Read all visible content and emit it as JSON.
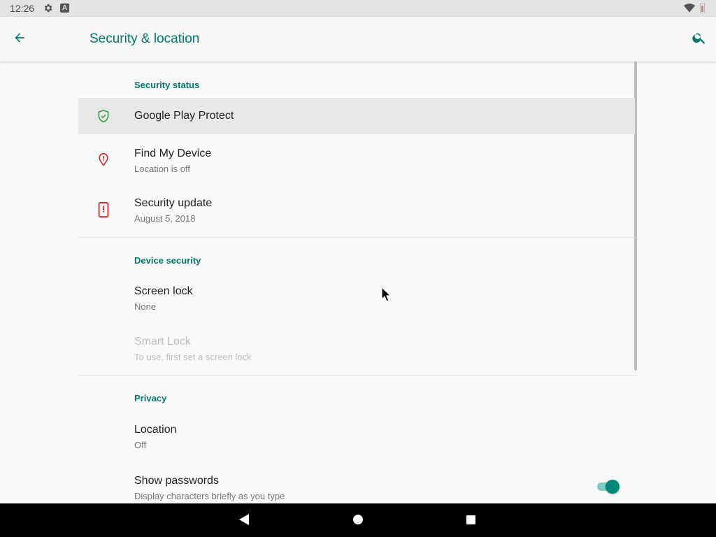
{
  "status_bar": {
    "time": "12:26",
    "icons": [
      "settings-icon",
      "a-notification-icon",
      "wifi-icon",
      "battery-icon"
    ]
  },
  "app_bar": {
    "title": "Security & location",
    "back_icon": "arrow-back-icon",
    "search_icon": "search-icon"
  },
  "sections": {
    "security_status": {
      "header": "Security status",
      "items": [
        {
          "title": "Google Play Protect",
          "summary": "",
          "icon": "shield-check-icon",
          "icon_color": "#43a047"
        },
        {
          "title": "Find My Device",
          "summary": "Location is off",
          "icon": "location-alert-icon",
          "icon_color": "#d32f2f"
        },
        {
          "title": "Security update",
          "summary": "August 5, 2018",
          "icon": "phone-alert-icon",
          "icon_color": "#d32f2f"
        }
      ]
    },
    "device_security": {
      "header": "Device security",
      "items": [
        {
          "title": "Screen lock",
          "summary": "None"
        },
        {
          "title": "Smart Lock",
          "summary": "To use, first set a screen lock",
          "enabled": false
        }
      ]
    },
    "privacy": {
      "header": "Privacy",
      "items": [
        {
          "title": "Location",
          "summary": "Off"
        },
        {
          "title": "Show passwords",
          "summary": "Display characters briefly as you type",
          "toggle_on": true
        }
      ]
    }
  },
  "colors": {
    "accent": "#00796b",
    "toggle_thumb": "#00897b",
    "toggle_track": "#80cbc4"
  },
  "nav_bar": {
    "buttons": [
      "back-triangle-icon",
      "home-circle-icon",
      "recents-square-icon"
    ]
  }
}
